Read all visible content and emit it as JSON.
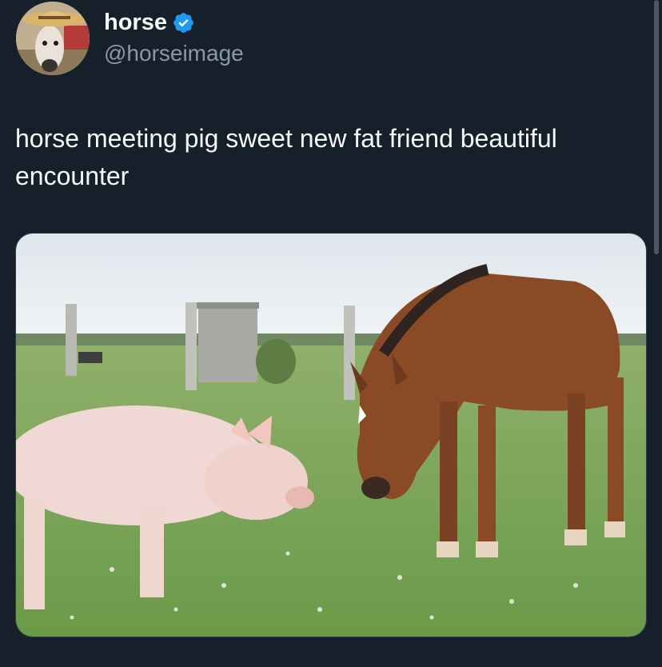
{
  "author": {
    "display_name": "horse",
    "handle": "@horseimage",
    "verified": true,
    "verified_icon": "verified-badge-icon",
    "verified_color": "#1d9bf0",
    "avatar_icon": "horse-in-straw-hat-avatar"
  },
  "tweet": {
    "text": "horse meeting pig sweet new fat friend beautiful encounter"
  },
  "media": {
    "subject": "foal-and-pig-in-field-photo"
  },
  "theme": {
    "background": "#15202b",
    "text_primary": "#f7f9f9",
    "text_secondary": "#8b98a5"
  }
}
